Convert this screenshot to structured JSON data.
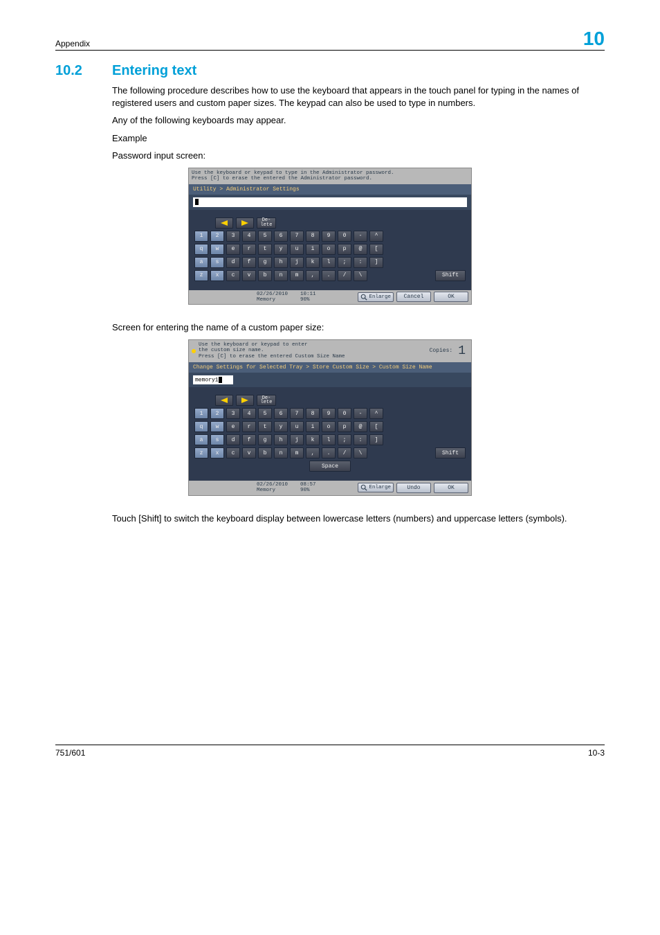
{
  "header": {
    "left": "Appendix",
    "chapter_number": "10"
  },
  "section": {
    "number": "10.2",
    "title": "Entering text"
  },
  "paragraphs": {
    "intro": "The following procedure describes how to use the keyboard that appears in the touch panel for typing in the names of registered users and custom paper sizes. The keypad can also be used to type in numbers.",
    "any_kb": "Any of the following keyboards may appear.",
    "example": "Example",
    "pw_screen": "Password input screen:",
    "custom_screen": "Screen for entering the name of a custom paper size:",
    "shift_note": "Touch [Shift] to switch the keyboard display between lowercase letters (numbers) and uppercase letters (symbols)."
  },
  "panel_common": {
    "delete_label": "De-\nlete",
    "shift_label": "Shift",
    "space_label": "Space",
    "enlarge_label": "Enlarge",
    "rows": {
      "num": [
        "1",
        "2",
        "3",
        "4",
        "5",
        "6",
        "7",
        "8",
        "9",
        "0",
        "-",
        "^"
      ],
      "qw": [
        "q",
        "w",
        "e",
        "r",
        "t",
        "y",
        "u",
        "i",
        "o",
        "p",
        "@",
        "["
      ],
      "as": [
        "a",
        "s",
        "d",
        "f",
        "g",
        "h",
        "j",
        "k",
        "l",
        ";",
        ":",
        "]"
      ],
      "zx": [
        "z",
        "x",
        "c",
        "v",
        "b",
        "n",
        "m",
        ",",
        ".",
        "/",
        "\\"
      ]
    }
  },
  "panel1": {
    "msg": "Use the keyboard or keypad to type in the Administrator password.\nPress [C] to erase the entered the Administrator password.",
    "breadcrumb": "Utility > Administrator Settings",
    "input_value": "",
    "status": {
      "date": "02/26/2010",
      "time": "10:11",
      "mem_label": "Memory",
      "mem_value": "90%",
      "cancel": "Cancel",
      "ok": "OK"
    }
  },
  "panel2": {
    "msg": "Use the keyboard or keypad to enter\nthe custom size name.\nPress [C] to erase the entered Custom Size Name",
    "copies_label": "Copies:",
    "copies_value": "1",
    "breadcrumb": "Change Settings for Selected Tray > Store Custom Size > Custom Size Name",
    "input_value": "memory1",
    "status": {
      "date": "02/26/2010",
      "time": "08:57",
      "mem_label": "Memory",
      "mem_value": "90%",
      "undo": "Undo",
      "ok": "OK"
    }
  },
  "footer": {
    "left": "751/601",
    "right": "10-3"
  }
}
